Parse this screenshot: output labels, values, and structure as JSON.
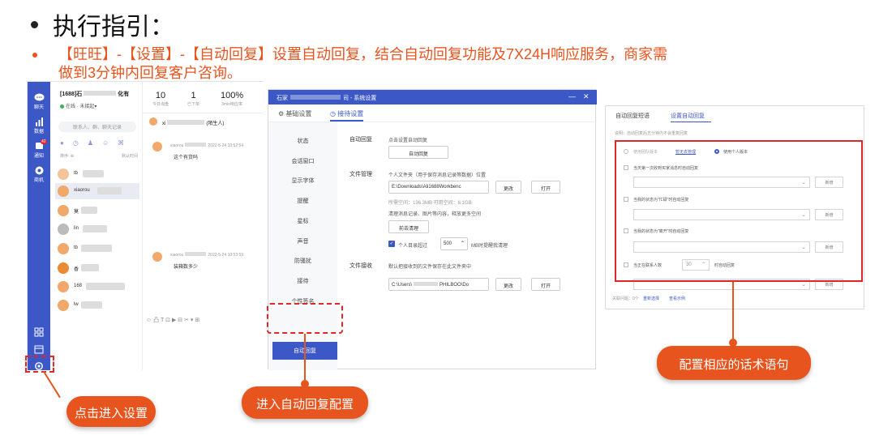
{
  "slide": {
    "title": "执行指引：",
    "subtitle": "【旺旺】-【设置】-【自动回复】设置自动回复，结合自动回复功能及7X24H响应服务，商家需做到3分钟内回复客户咨询。"
  },
  "chat": {
    "rail": [
      {
        "icon": "chat-icon",
        "label": "聊天"
      },
      {
        "icon": "bar-chart-icon",
        "label": "数据"
      },
      {
        "icon": "bell-icon",
        "label": "通知",
        "badge": "42"
      },
      {
        "icon": "store-icon",
        "label": "商机"
      }
    ],
    "account_name": "[1688]石",
    "account_suffix": "化有",
    "status_online": "在线",
    "status_pending": "未接起",
    "stats": [
      {
        "value": "10",
        "label": "今日询盘"
      },
      {
        "value": "1",
        "label": "已下单"
      },
      {
        "value": "100%",
        "label": "3min响应率"
      }
    ],
    "search_placeholder": "联系人、群、聊天记录",
    "sort_label": "排序: ⊕",
    "sort_right": "默认时间",
    "contacts": [
      "tb",
      "xiaorou",
      "莫",
      "lin",
      "tb",
      "香",
      "168",
      "lw"
    ],
    "chat_title": "xi",
    "chat_title_tag": "(陌生人)",
    "msg1_sender": "xiaorou",
    "msg1_time": "2022-5-24 10:52:54",
    "msg1_text": "这个有货吗",
    "msg2_sender": "xiaorou",
    "msg2_time": "2022-5-24 10:53:59",
    "msg2_text": "装箱数多少",
    "toolbar": "☺ 凸 T ⊡ ▶ ⊟ ✂ ▾ ⊞"
  },
  "settings": {
    "window_title": "石家",
    "window_title_suffix": "司 - 系统设置",
    "tab_basic": "基础设置",
    "tab_service": "接待设置",
    "sidebar": [
      "状态",
      "会话窗口",
      "显示字体",
      "提醒",
      "星标",
      "声音",
      "防骚扰",
      "接待",
      "个性签名"
    ],
    "sidebar_active": "自动回复",
    "auto_reply_label": "自动回复",
    "auto_reply_hint": "点击设置自动回复",
    "auto_reply_button": "自动回复",
    "file_mgmt_label": "文件管理",
    "file_mgmt_hint": "个人文件夹（用于保存消息记录等数据）位置",
    "file_path": "E:\\Downloads\\Ali1688Workbenc",
    "btn_change": "更改",
    "btn_open": "打开",
    "space_info": "所需空间：136.3MB   可用空间：6.1GB",
    "clean_hint": "清理消息记录、图片等内容，释放更多空间",
    "clean_button": "前去清理",
    "dir_limit_pre": "个人目录超过",
    "dir_limit_value": "500",
    "dir_limit_post": "MB时提醒我清理",
    "file_recv_label": "文件接收",
    "file_recv_hint": "默认把接收到的文件保存在此文件夹中",
    "recv_path_a": "C:\\Users\\",
    "recv_path_b": "PHILBOO\\Do"
  },
  "autoreply": {
    "tab_phrases": "自动回复短语",
    "tab_setup": "设置自动回复",
    "note": "说明：自动回复后五分钟内不会重复回复",
    "team_version": "使用团队版本",
    "temp_manage": "暂无去管理",
    "personal_version": "使用个人版本",
    "opt1": "当天第一次收到买家消息时自动回复",
    "opt2": "当我的状态为“忙碌”时自动回复",
    "opt3": "当我的状态为“离开”时自动回复",
    "opt4_pre": "当正在联系人数",
    "opt4_value": "30",
    "opt4_post": "时自动回复",
    "add": "新增",
    "footer_count": "关联问题：0个",
    "reselect": "重新选择",
    "view_example": "查看示例"
  },
  "callouts": {
    "enter_settings": "点击进入设置",
    "enter_autoreply": "进入自动回复配置",
    "config_phrases": "配置相应的话术语句"
  },
  "colors": {
    "accent_orange": "#e8541e",
    "brand_blue": "#3c58c7",
    "highlight_red": "#e02626"
  }
}
